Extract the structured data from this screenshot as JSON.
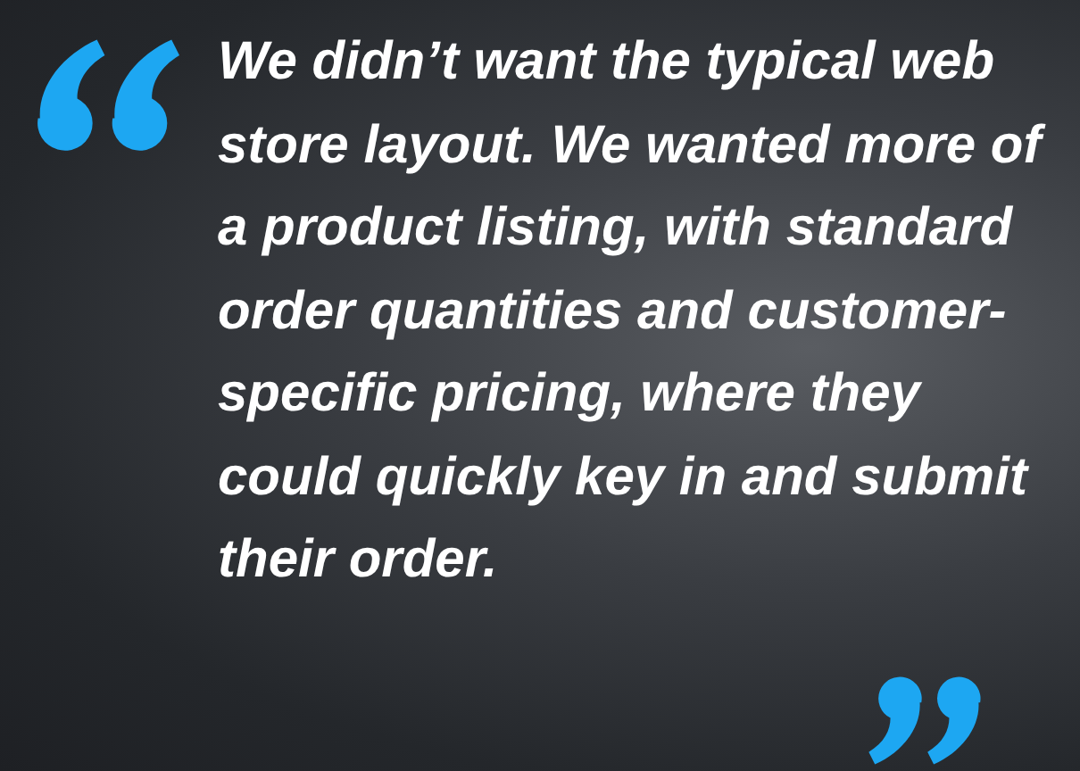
{
  "testimonial": {
    "quote": "We didn’t want the typical web store layout. We wanted more of a product listing, with standard order quantities and customer-specific pricing, where they could quickly key in and submit their order."
  }
}
